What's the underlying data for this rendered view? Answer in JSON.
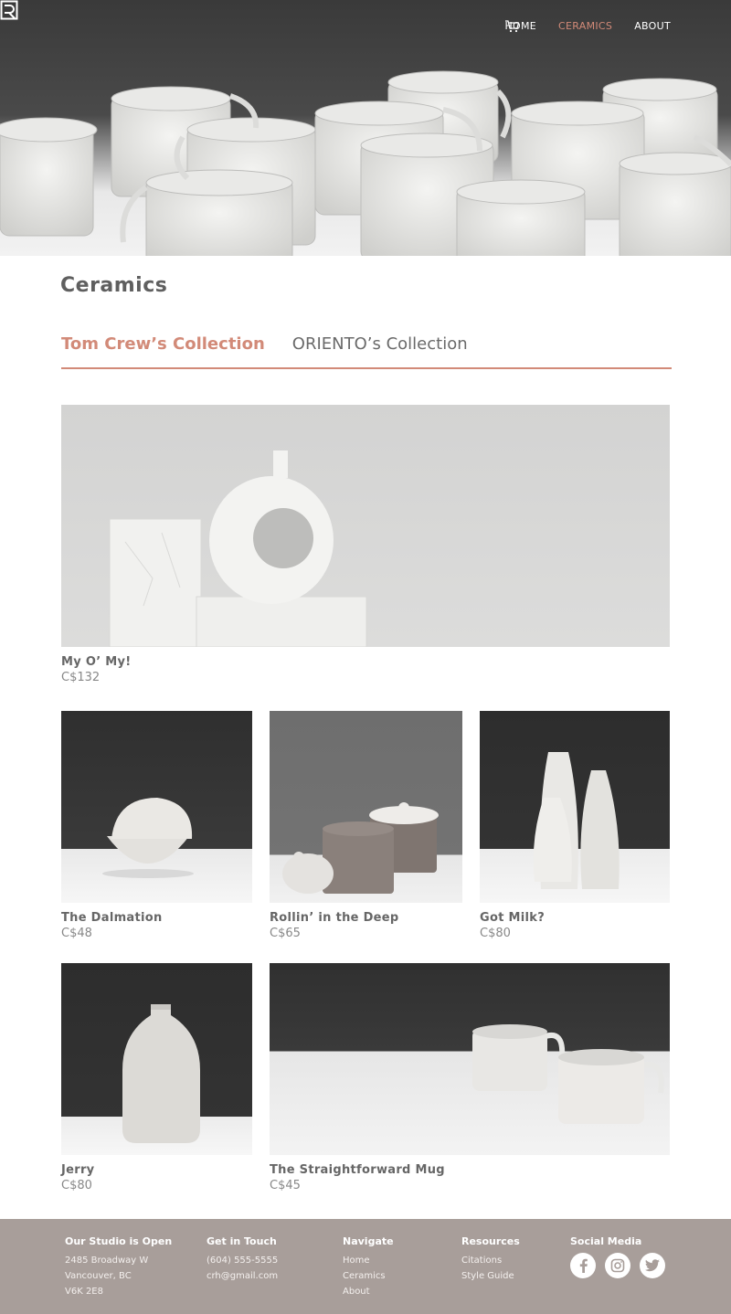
{
  "nav": {
    "home": "HOME",
    "ceramics": "CERAMICS",
    "about": "ABOUT",
    "active_color": "#d28a78"
  },
  "page": {
    "title": "Ceramics"
  },
  "tabs": [
    {
      "label": "Tom Crew’s Collection",
      "active": true
    },
    {
      "label": "ORIENTO’s Collection",
      "active": false
    }
  ],
  "products": [
    {
      "name": "My O’ My!",
      "price": "C$132"
    },
    {
      "name": "The Dalmation",
      "price": "C$48"
    },
    {
      "name": "Rollin’ in the Deep",
      "price": "C$65"
    },
    {
      "name": "Got Milk?",
      "price": "C$80"
    },
    {
      "name": "Jerry",
      "price": "C$80"
    },
    {
      "name": "The Straightforward Mug",
      "price": "C$45"
    }
  ],
  "footer": {
    "studio": {
      "heading": "Our Studio is Open",
      "lines": [
        "2485 Broadway W",
        "Vancouver, BC",
        "V6K 2E8"
      ]
    },
    "contact": {
      "heading": "Get in Touch",
      "lines": [
        "(604) 555-5555",
        "crh@gmail.com"
      ]
    },
    "navigate": {
      "heading": "Navigate",
      "links": [
        "Home",
        "Ceramics",
        "About"
      ]
    },
    "resources": {
      "heading": "Resources",
      "links": [
        "Citations",
        "Style Guide"
      ]
    },
    "social": {
      "heading": "Social Media",
      "icons": [
        "facebook-icon",
        "instagram-icon",
        "twitter-icon"
      ]
    }
  },
  "colors": {
    "accent": "#d28a78",
    "footer_bg": "#a89e9a"
  }
}
